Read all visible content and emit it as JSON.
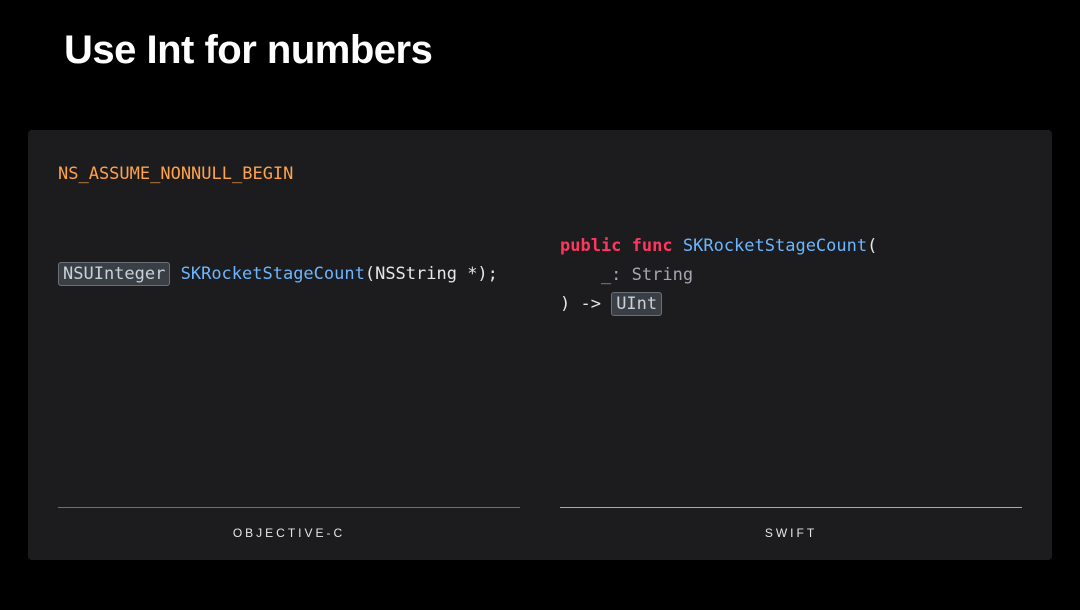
{
  "title": "Use Int for numbers",
  "macro": "NS_ASSUME_NONNULL_BEGIN",
  "objc": {
    "highlight_type": "NSUInteger",
    "func_name": "SKRocketStageCount",
    "params": "(NSString *);",
    "label": "OBJECTIVE-C"
  },
  "swift": {
    "kw_public": "public",
    "kw_func": "func",
    "func_name": "SKRocketStageCount",
    "open_paren": "(",
    "param_line": "    _: String",
    "close_arrow": ") -> ",
    "highlight_ret": "UInt",
    "label": "SWIFT"
  }
}
